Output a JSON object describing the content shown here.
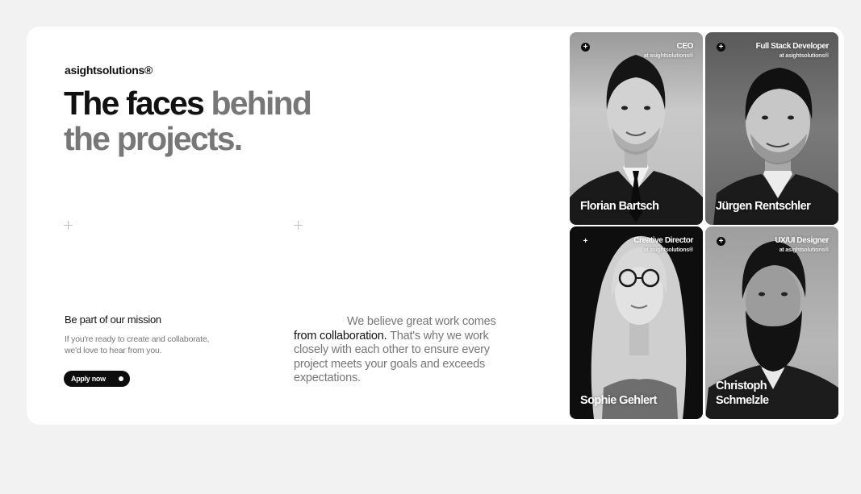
{
  "brand": {
    "name": "asightsolutions®"
  },
  "hero": {
    "headline_dark": "The faces",
    "headline_gray": "behind the projects."
  },
  "mission": {
    "title": "Be part of our mission",
    "text": "If you're ready to create and collaborate, we'd love to hear from you.",
    "button_label": "Apply now"
  },
  "belief": {
    "lead": "We believe great work comes",
    "emphasis": "from collaboration.",
    "rest": "That's why we work closely with each other to ensure every project meets your goals and exceeds expectations."
  },
  "team": [
    {
      "name": "Florian Bartsch",
      "role": "CEO",
      "company": "at asightsolutions®",
      "add_icon": "+"
    },
    {
      "name": "Jürgen Rentschler",
      "role": "Full Stack Developer",
      "company": "at asightsolutions®",
      "add_icon": "+"
    },
    {
      "name": "Sophie Gehlert",
      "role": "Creative Director",
      "company": "at asightsolutions®",
      "add_icon": "+"
    },
    {
      "name": "Christoph Schmelzle",
      "role": "UX/UI Designer",
      "company": "at asightsolutions®",
      "add_icon": "+"
    }
  ],
  "colors": {
    "page_bg": "#f2f2f2",
    "card_bg": "#ffffff",
    "text_dark": "#111111",
    "text_gray": "#777777",
    "button_bg": "#0d0d0d"
  }
}
